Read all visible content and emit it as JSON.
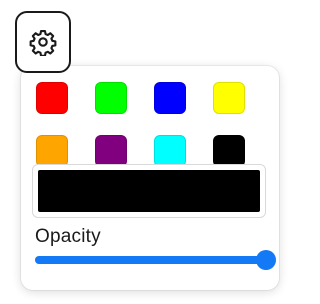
{
  "settings_button": {
    "icon": "gear-icon"
  },
  "color_picker": {
    "swatches": [
      {
        "name": "red",
        "color": "#ff0000"
      },
      {
        "name": "green",
        "color": "#00ff00"
      },
      {
        "name": "blue",
        "color": "#0000ff"
      },
      {
        "name": "yellow",
        "color": "#ffff00"
      },
      {
        "name": "orange",
        "color": "#ffa500"
      },
      {
        "name": "purple",
        "color": "#800080"
      },
      {
        "name": "cyan",
        "color": "#00ffff"
      },
      {
        "name": "black",
        "color": "#000000"
      }
    ],
    "selected_color": "#000000",
    "opacity_label": "Opacity",
    "opacity_value": 1.0,
    "accent_color": "#1479f5"
  }
}
